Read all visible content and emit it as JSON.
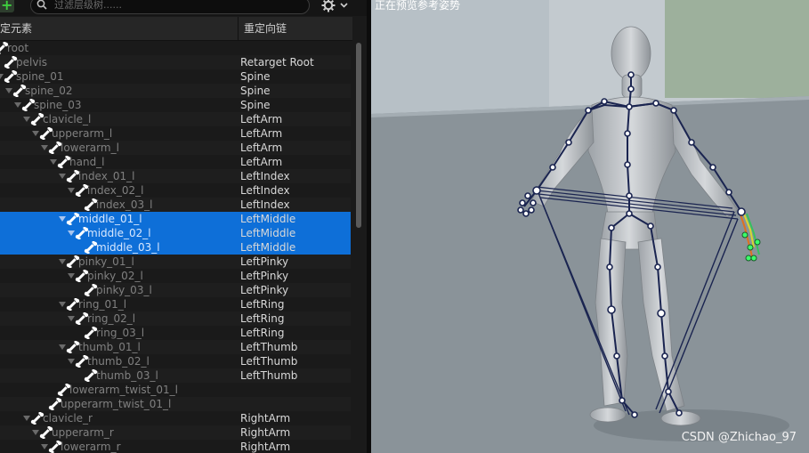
{
  "toolbar": {
    "add_label": "+",
    "search_placeholder": "过滤层级树......",
    "settings_icon": "gear-icon"
  },
  "tree": {
    "headers": {
      "bone": "定元素",
      "chain": "重定向链"
    },
    "rows": [
      {
        "name": "root",
        "chain": "",
        "depth": 0,
        "expanded": false,
        "selected": false
      },
      {
        "name": "pelvis",
        "chain": "Retarget Root",
        "depth": 1,
        "expanded": false,
        "selected": false
      },
      {
        "name": "spine_01",
        "chain": "Spine",
        "depth": 1,
        "expanded": true,
        "selected": false
      },
      {
        "name": "spine_02",
        "chain": "Spine",
        "depth": 2,
        "expanded": true,
        "selected": false
      },
      {
        "name": "spine_03",
        "chain": "Spine",
        "depth": 3,
        "expanded": true,
        "selected": false
      },
      {
        "name": "clavicle_l",
        "chain": "LeftArm",
        "depth": 4,
        "expanded": true,
        "selected": false
      },
      {
        "name": "upperarm_l",
        "chain": "LeftArm",
        "depth": 5,
        "expanded": true,
        "selected": false
      },
      {
        "name": "lowerarm_l",
        "chain": "LeftArm",
        "depth": 6,
        "expanded": true,
        "selected": false
      },
      {
        "name": "hand_l",
        "chain": "LeftArm",
        "depth": 7,
        "expanded": true,
        "selected": false
      },
      {
        "name": "index_01_l",
        "chain": "LeftIndex",
        "depth": 8,
        "expanded": true,
        "selected": false
      },
      {
        "name": "index_02_l",
        "chain": "LeftIndex",
        "depth": 9,
        "expanded": true,
        "selected": false
      },
      {
        "name": "index_03_l",
        "chain": "LeftIndex",
        "depth": 10,
        "expanded": false,
        "selected": false
      },
      {
        "name": "middle_01_l",
        "chain": "LeftMiddle",
        "depth": 8,
        "expanded": true,
        "selected": true
      },
      {
        "name": "middle_02_l",
        "chain": "LeftMiddle",
        "depth": 9,
        "expanded": true,
        "selected": true
      },
      {
        "name": "middle_03_l",
        "chain": "LeftMiddle",
        "depth": 10,
        "expanded": false,
        "selected": true
      },
      {
        "name": "pinky_01_l",
        "chain": "LeftPinky",
        "depth": 8,
        "expanded": true,
        "selected": false
      },
      {
        "name": "pinky_02_l",
        "chain": "LeftPinky",
        "depth": 9,
        "expanded": true,
        "selected": false
      },
      {
        "name": "pinky_03_l",
        "chain": "LeftPinky",
        "depth": 10,
        "expanded": false,
        "selected": false
      },
      {
        "name": "ring_01_l",
        "chain": "LeftRing",
        "depth": 8,
        "expanded": true,
        "selected": false
      },
      {
        "name": "ring_02_l",
        "chain": "LeftRing",
        "depth": 9,
        "expanded": true,
        "selected": false
      },
      {
        "name": "ring_03_l",
        "chain": "LeftRing",
        "depth": 10,
        "expanded": false,
        "selected": false
      },
      {
        "name": "thumb_01_l",
        "chain": "LeftThumb",
        "depth": 8,
        "expanded": true,
        "selected": false
      },
      {
        "name": "thumb_02_l",
        "chain": "LeftThumb",
        "depth": 9,
        "expanded": true,
        "selected": false
      },
      {
        "name": "thumb_03_l",
        "chain": "LeftThumb",
        "depth": 10,
        "expanded": false,
        "selected": false
      },
      {
        "name": "lowerarm_twist_01_l",
        "chain": "",
        "depth": 7,
        "expanded": false,
        "selected": false
      },
      {
        "name": "upperarm_twist_01_l",
        "chain": "",
        "depth": 6,
        "expanded": false,
        "selected": false
      },
      {
        "name": "clavicle_r",
        "chain": "RightArm",
        "depth": 4,
        "expanded": true,
        "selected": false
      },
      {
        "name": "upperarm_r",
        "chain": "RightArm",
        "depth": 5,
        "expanded": true,
        "selected": false
      },
      {
        "name": "lowerarm_r",
        "chain": "RightArm",
        "depth": 6,
        "expanded": true,
        "selected": false
      }
    ]
  },
  "viewport": {
    "label": "正在预览参考姿势",
    "watermark": "CSDN @Zhichao_97",
    "skeleton_color": "#1a2450",
    "floor_color": "#8a9399"
  }
}
